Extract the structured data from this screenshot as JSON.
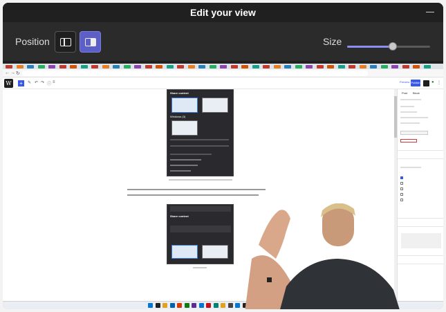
{
  "dialog": {
    "title": "Edit your view",
    "position_label": "Position",
    "size_label": "Size",
    "size_level": 0.55,
    "selected_position": "right"
  },
  "screen": {
    "wordpress": {
      "publish_label": "Publish",
      "preview_label": "Preview"
    },
    "share_panel_1": {
      "header": "Share content",
      "windows_label": "Windows (3)"
    },
    "share_panel_2": {
      "header": "Share content"
    },
    "paragraph_lines": [
      "But if you have this in your screen, and all you do is apply effect with the same camera that",
      "This was the feature I was missing earlier but upon installing Camera, they have appeared again."
    ],
    "sidebar_tabs": [
      "Post",
      "Block"
    ]
  },
  "colors": {
    "accent": "#5b5fc7",
    "wp_blue": "#3858e9",
    "dialog_bg": "#202020"
  }
}
